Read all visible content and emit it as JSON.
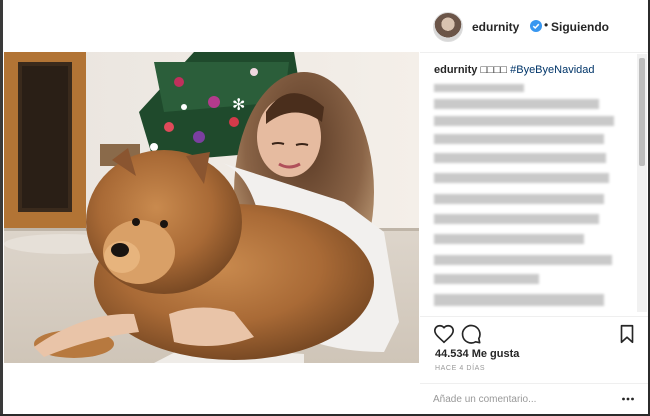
{
  "post": {
    "author": {
      "username": "edurnity",
      "verified": true,
      "separator": "•",
      "follow_status": "Siguiendo"
    },
    "caption": {
      "username": "edurnity",
      "emoji_text": "□□□□",
      "hashtag": "#ByeByeNavidad"
    },
    "likes_text": "44.534 Me gusta",
    "time_ago": "HACE 4 DÍAS",
    "comment_placeholder": "Añade un comentario...",
    "icons": {
      "like": "heart-icon",
      "comment": "comment-bubble-icon",
      "save": "bookmark-icon",
      "more": "more-options-icon",
      "verified": "verified-badge-icon"
    },
    "colors": {
      "hashtag": "#003569",
      "verified": "#3897f0",
      "text": "#262626",
      "muted": "#999999"
    }
  }
}
